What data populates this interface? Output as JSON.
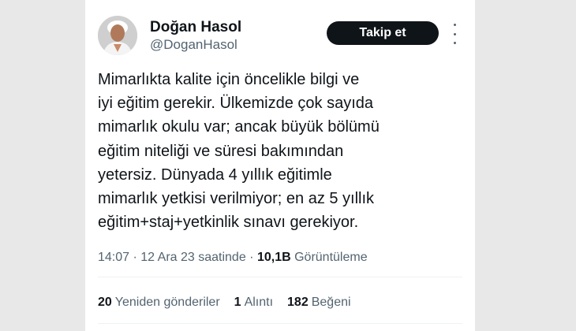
{
  "profile": {
    "display_name": "Doğan Hasol",
    "handle": "@DoganHasol"
  },
  "follow_button": "Takip et",
  "more_icon": "more-vertical-icon",
  "tweet": {
    "lines": [
      "Mimarlıkta kalite için öncelikle bilgi ve",
      "iyi eğitim gerekir. Ülkemizde çok sayıda",
      "mimarlık okulu var; ancak büyük bölümü",
      "eğitim niteliği ve süresi bakımından",
      "yetersiz. Dünyada 4 yıllık eğitimle",
      "mimarlık yetkisi verilmiyor; en az 5 yıllık",
      "eğitim+staj+yetkinlik sınavı gerekiyor."
    ]
  },
  "meta": {
    "time": "14:07",
    "separator": "·",
    "date": "12 Ara 23 saatinde",
    "views_count": "10,1B",
    "views_label": "Görüntüleme"
  },
  "stats": {
    "reposts_count": "20",
    "reposts_label": "Yeniden gönderiler",
    "quotes_count": "1",
    "quotes_label": "Alıntı",
    "likes_count": "182",
    "likes_label": "Beğeni"
  }
}
